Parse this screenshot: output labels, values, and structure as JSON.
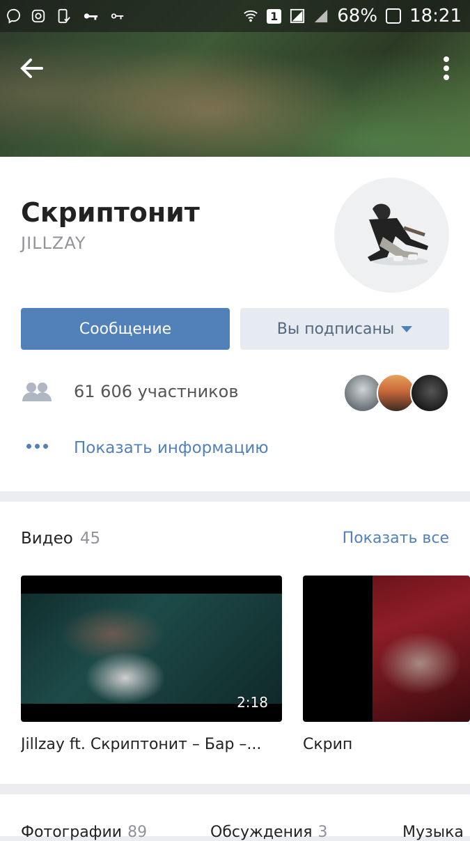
{
  "status_bar": {
    "battery_percent": "68%",
    "sim_indicator": "1",
    "time": "18:21",
    "icons": [
      "viber-icon",
      "instagram-icon",
      "device-check-icon",
      "key-icon",
      "key-small-icon",
      "wifi-icon",
      "signal-icon"
    ]
  },
  "header": {
    "back_icon": "arrow-left-icon",
    "menu_icon": "more-vertical-icon"
  },
  "profile": {
    "name": "Скриптонит",
    "screen_name": "JILLZAY",
    "message_button": "Сообщение",
    "subscribed_button": "Вы подписаны",
    "members_text": "61 606 участников",
    "show_info": "Показать информацию"
  },
  "video_section": {
    "title": "Видео",
    "count": "45",
    "show_all": "Показать все",
    "videos": [
      {
        "title": "Jillzay ft. Скриптонит – Бар –...",
        "duration": "2:18"
      },
      {
        "title": "Скрип",
        "duration": ""
      }
    ]
  },
  "bottom_tabs": [
    {
      "label": "Фотографии",
      "count": "89"
    },
    {
      "label": "Обсуждения",
      "count": "3"
    },
    {
      "label": "Музыка",
      "count": ""
    }
  ],
  "colors": {
    "accent": "#5181b8",
    "secondary_button_bg": "#e5ebf1",
    "muted_text": "#909399"
  }
}
